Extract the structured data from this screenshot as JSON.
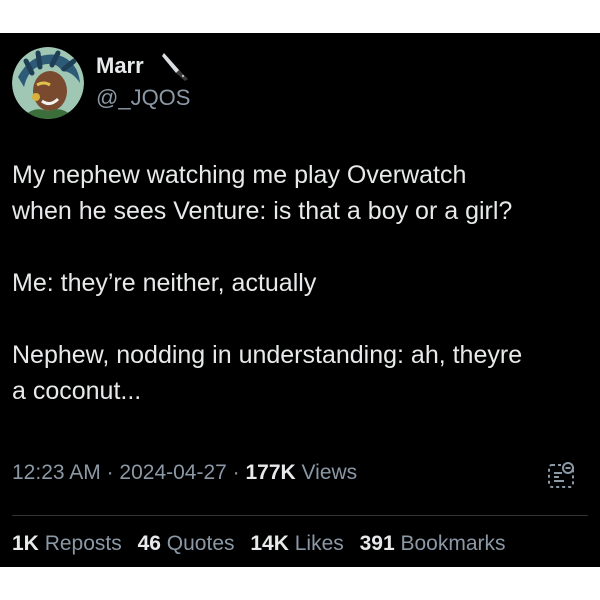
{
  "user": {
    "display_name": "Marr",
    "handle": "@_JQOS",
    "name_emoji": "knife-icon",
    "avatar": "avatar-illustration"
  },
  "tweet": {
    "text": "My nephew watching me play Overwatch\nwhen he sees Venture: is that a boy or a girl?\n\nMe: they’re neither, actually\n\nNephew, nodding in understanding: ah, theyre\na coconut..."
  },
  "meta": {
    "time": "12:23 AM",
    "sep1": " · ",
    "date": "2024-04-27",
    "sep2": " · ",
    "views_count": "177K",
    "views_label": " Views"
  },
  "stats": {
    "reposts_count": "1K",
    "reposts_label": "Reposts",
    "quotes_count": "46",
    "quotes_label": "Quotes",
    "likes_count": "14K",
    "likes_label": "Likes",
    "bookmarks_count": "391",
    "bookmarks_label": "Bookmarks"
  },
  "colors": {
    "background": "#000000",
    "text_primary": "#e7e9ea",
    "text_secondary": "#8b98a5",
    "divider": "#2f3336"
  }
}
